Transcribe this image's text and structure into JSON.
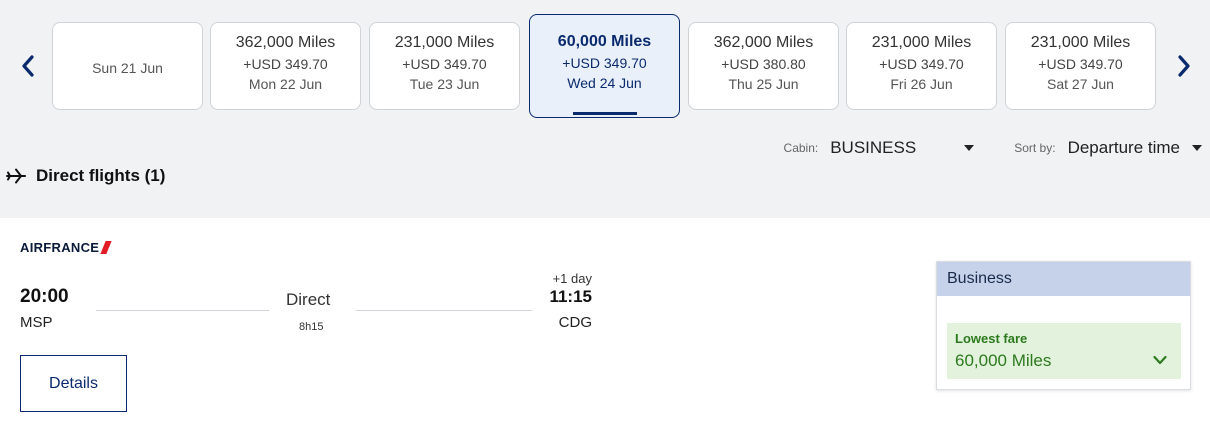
{
  "date_strip": {
    "cards": [
      {
        "miles": "",
        "usd": "",
        "date": "Sun 21 Jun",
        "selected": false
      },
      {
        "miles": "362,000 Miles",
        "usd": "+USD 349.70",
        "date": "Mon 22 Jun",
        "selected": false
      },
      {
        "miles": "231,000 Miles",
        "usd": "+USD 349.70",
        "date": "Tue 23 Jun",
        "selected": false
      },
      {
        "miles": "60,000 Miles",
        "usd": "+USD 349.70",
        "date": "Wed 24 Jun",
        "selected": true
      },
      {
        "miles": "362,000 Miles",
        "usd": "+USD 380.80",
        "date": "Thu 25 Jun",
        "selected": false
      },
      {
        "miles": "231,000 Miles",
        "usd": "+USD 349.70",
        "date": "Fri 26 Jun",
        "selected": false
      },
      {
        "miles": "231,000 Miles",
        "usd": "+USD 349.70",
        "date": "Sat 27 Jun",
        "selected": false
      }
    ]
  },
  "controls": {
    "cabin_label": "Cabin:",
    "cabin_value": "BUSINESS",
    "sort_label": "Sort by:",
    "sort_value": "Departure time"
  },
  "section": {
    "title": "Direct flights (1)"
  },
  "flight": {
    "airline": "AIRFRANCE",
    "dep_time": "20:00",
    "dep_airport": "MSP",
    "stops": "Direct",
    "duration": "8h15",
    "plus_day": "+1 day",
    "arr_time": "11:15",
    "arr_airport": "CDG",
    "details_label": "Details"
  },
  "fare": {
    "cabin_header": "Business",
    "label": "Lowest fare",
    "miles": "60,000 Miles"
  },
  "colors": {
    "accent": "#0a2a6e",
    "fare_green": "#2d7a1e",
    "fare_bg": "#e2f2dc",
    "fare_header_bg": "#c5d2ea",
    "airline_red": "#e21c24"
  }
}
